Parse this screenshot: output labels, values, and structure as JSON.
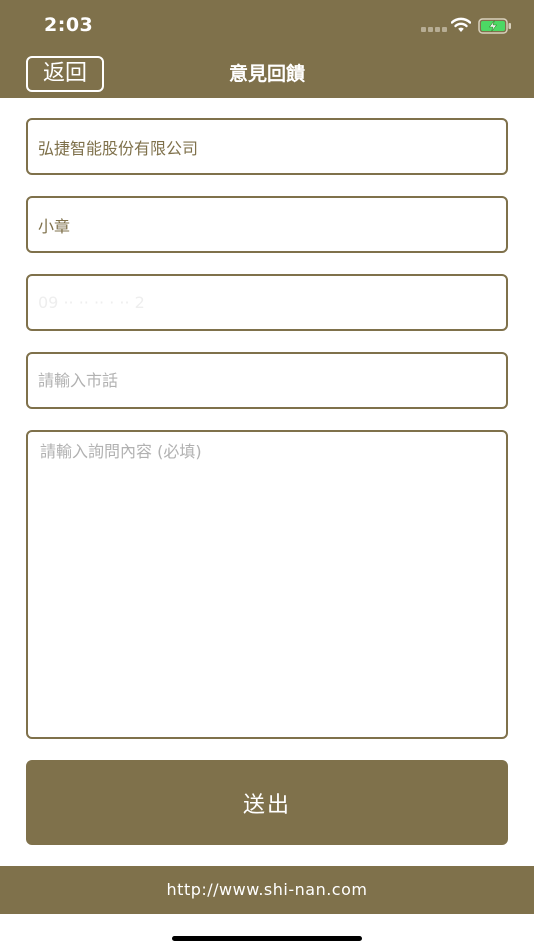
{
  "status_bar": {
    "time": "2:03"
  },
  "nav": {
    "back_label": "返回",
    "title": "意見回饋"
  },
  "form": {
    "company_value": "弘捷智能股份有限公司",
    "name_value": "小章",
    "mobile_value": "09 ·· ·· ·· · ·· 2",
    "phone_placeholder": "請輸入市話",
    "message_placeholder": "請輸入詢問內容 (必填)",
    "submit_label": "送出"
  },
  "footer": {
    "url": "http://www.shi-nan.com"
  },
  "colors": {
    "brand": "#7f714b",
    "placeholder": "#b1b1b1"
  }
}
